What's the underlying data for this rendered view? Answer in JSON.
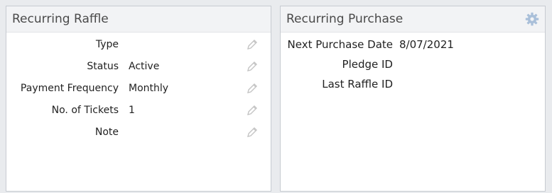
{
  "recurring_raffle": {
    "title": "Recurring Raffle",
    "fields": [
      {
        "label": "Type",
        "value": ""
      },
      {
        "label": "Status",
        "value": "Active"
      },
      {
        "label": "Payment Frequency",
        "value": "Monthly"
      },
      {
        "label": "No. of Tickets",
        "value": "1"
      },
      {
        "label": "Note",
        "value": ""
      }
    ],
    "edit_icon": "pencil-icon"
  },
  "recurring_purchase": {
    "title": "Recurring Purchase",
    "settings_icon": "gear-icon",
    "fields": [
      {
        "label": "Next Purchase Date",
        "value": "8/07/2021"
      },
      {
        "label": "Pledge ID",
        "value": ""
      },
      {
        "label": "Last Raffle ID",
        "value": ""
      }
    ]
  },
  "colors": {
    "panel_header_bg": "#f2f3f5",
    "gear": "#a9bfd9",
    "pencil": "#c4c4c4"
  }
}
